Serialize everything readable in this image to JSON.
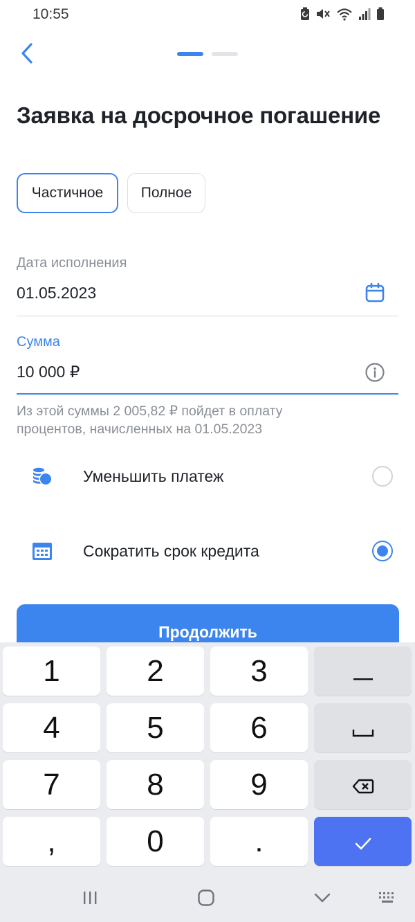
{
  "status_bar": {
    "time": "10:55",
    "icons": [
      "battery-saver-icon",
      "mute-icon",
      "wifi-icon",
      "signal-icon",
      "battery-icon"
    ]
  },
  "header": {
    "back_icon": "chevron-left-icon",
    "steps_total": 2,
    "steps_current": 1
  },
  "page": {
    "title": "Заявка на досрочное погашение"
  },
  "payment_type": {
    "options": [
      "Частичное",
      "Полное"
    ],
    "selected": "Частичное"
  },
  "date_field": {
    "label": "Дата исполнения",
    "value": "01.05.2023",
    "icon": "calendar-icon"
  },
  "sum_field": {
    "label": "Сумма",
    "value": "10 000 ₽",
    "icon": "info-icon",
    "hint_line1": "Из этой суммы 2 005,82 ₽ пойдет в оплату",
    "hint_line2": "процентов, начисленных на 01.05.2023"
  },
  "options": [
    {
      "label": "Уменьшить платеж",
      "icon": "coins-icon",
      "selected": false
    },
    {
      "label": "Сократить срок кредита",
      "icon": "calendar-grid-icon",
      "selected": true
    }
  ],
  "continue_label": "Продолжить",
  "keyboard": {
    "keys": [
      "1",
      "2",
      "3",
      "4",
      "5",
      "6",
      "7",
      "8",
      "9",
      ",",
      "0",
      "."
    ],
    "fn_keys": [
      "minus-icon",
      "space-icon",
      "backspace-icon",
      "check-icon"
    ]
  },
  "nav_bar": [
    "recent-apps-icon",
    "home-icon",
    "hide-keyboard-icon",
    "keyboard-switch-icon"
  ],
  "colors": {
    "accent": "#3d85ee",
    "enter_key": "#4d72f2",
    "text": "#1f2329",
    "muted": "#8a8f96"
  }
}
